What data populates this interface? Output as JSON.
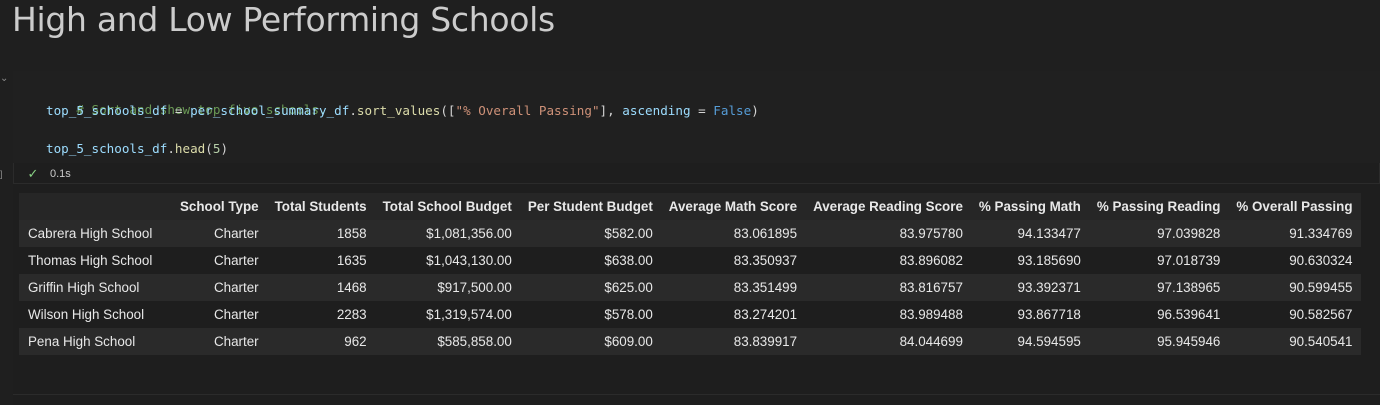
{
  "markdown": {
    "title": "High and Low Performing Schools"
  },
  "code_cell": {
    "line1_comment": "# Sort and show top five schools.",
    "line2_var": "top_5_schools_df",
    "line2_eq": " = ",
    "line2_obj": "per_school_summary_df",
    "line2_dot": ".",
    "line2_fn": "sort_values",
    "line2_open": "([",
    "line2_str": "\"% Overall Passing\"",
    "line2_mid": "], ",
    "line2_kwarg": "ascending",
    "line2_eq2": " = ",
    "line2_kw": "False",
    "line2_close": ")",
    "line4_var": "top_5_schools_df",
    "line4_dot": ".",
    "line4_fn": "head",
    "line4_open": "(",
    "line4_num": "5",
    "line4_close": ")",
    "exec_time": "0.1s",
    "exec_marker": "]"
  },
  "table": {
    "columns": [
      "School Type",
      "Total Students",
      "Total School Budget",
      "Per Student Budget",
      "Average Math Score",
      "Average Reading Score",
      "% Passing Math",
      "% Passing Reading",
      "% Overall Passing"
    ],
    "rows": [
      {
        "index": "Cabrera High School",
        "cells": [
          "Charter",
          "1858",
          "$1,081,356.00",
          "$582.00",
          "83.061895",
          "83.975780",
          "94.133477",
          "97.039828",
          "91.334769"
        ]
      },
      {
        "index": "Thomas High School",
        "cells": [
          "Charter",
          "1635",
          "$1,043,130.00",
          "$638.00",
          "83.350937",
          "83.896082",
          "93.185690",
          "97.018739",
          "90.630324"
        ]
      },
      {
        "index": "Griffin High School",
        "cells": [
          "Charter",
          "1468",
          "$917,500.00",
          "$625.00",
          "83.351499",
          "83.816757",
          "93.392371",
          "97.138965",
          "90.599455"
        ]
      },
      {
        "index": "Wilson High School",
        "cells": [
          "Charter",
          "2283",
          "$1,319,574.00",
          "$578.00",
          "83.274201",
          "83.989488",
          "93.867718",
          "96.539641",
          "90.582567"
        ]
      },
      {
        "index": "Pena High School",
        "cells": [
          "Charter",
          "962",
          "$585,858.00",
          "$609.00",
          "83.839917",
          "84.044699",
          "94.594595",
          "95.945946",
          "90.540541"
        ]
      }
    ]
  },
  "colors": {
    "background": "#1f1f1f",
    "comment": "#6a9955",
    "variable": "#9cdcfe",
    "function": "#dcdcaa",
    "string": "#ce9178",
    "keyword": "#569cd6",
    "number": "#b5cea8",
    "success": "#89d185"
  },
  "icons": {
    "collapse": "chevron-down-icon",
    "status": "check-icon"
  }
}
